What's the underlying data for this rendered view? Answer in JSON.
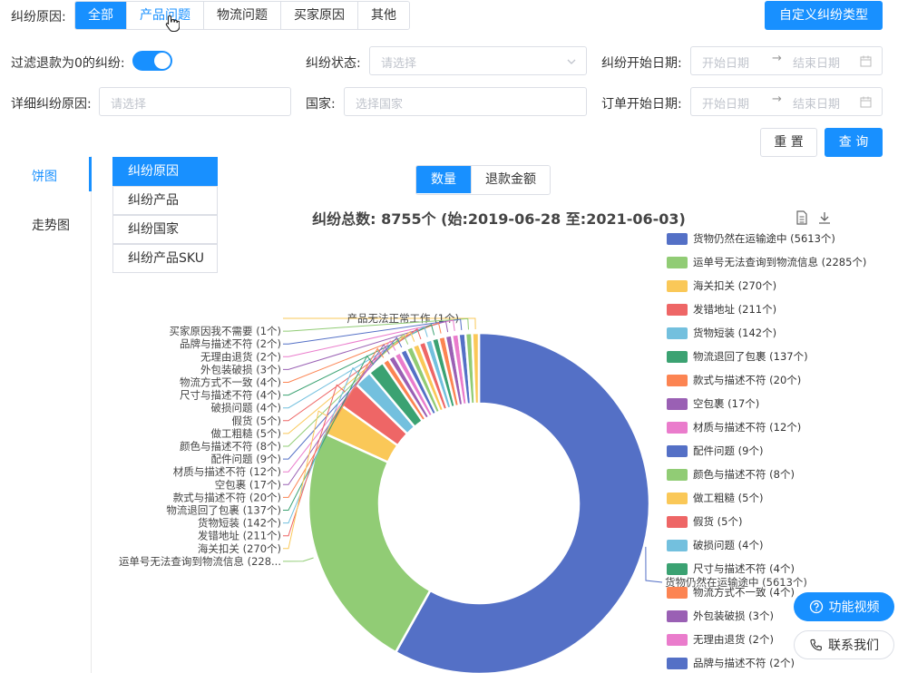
{
  "filters": {
    "reason_label": "纠纷原因:",
    "reason_tabs": [
      "全部",
      "产品问题",
      "物流问题",
      "买家原因",
      "其他"
    ],
    "custom_type_button": "自定义纠纷类型",
    "filter_zero_refund_label": "过滤退款为0的纠纷:",
    "status_label": "纠纷状态:",
    "status_placeholder": "请选择",
    "dispute_start_label": "纠纷开始日期:",
    "start_date_placeholder": "开始日期",
    "end_date_placeholder": "结束日期",
    "detail_reason_label": "详细纠纷原因:",
    "detail_reason_placeholder": "请选择",
    "country_label": "国家:",
    "country_placeholder": "选择国家",
    "order_start_label": "订单开始日期:",
    "order_start_date_placeholder": "开始日期",
    "order_end_date_placeholder": "结束日期",
    "reset_button": "重 置",
    "query_button": "查 询"
  },
  "side_tabs": [
    "饼图",
    "走势图"
  ],
  "dimension_buttons": [
    "纠纷原因",
    "纠纷产品",
    "纠纷国家",
    "纠纷产品SKU"
  ],
  "metric_tabs": [
    "数量",
    "退款金额"
  ],
  "float_buttons": {
    "video": "功能视频",
    "contact": "联系我们"
  },
  "colors": {
    "primary": "#1890ff"
  },
  "chart_data": {
    "type": "pie",
    "donut": true,
    "title": "纠纷总数: 8755个 (始:2019-06-28 至:2021-06-03)",
    "legend_position": "right",
    "callout_label": "货物仍然在运输途中 (5613个)",
    "truncated_label": "运单号无法查询到物流信息 (228...",
    "series": [
      {
        "name": "货物仍然在运输途中",
        "value": 5613,
        "label": "货物仍然在运输途中 (5613个)",
        "color": "#5470c6"
      },
      {
        "name": "运单号无法查询到物流信息",
        "value": 2285,
        "label": "运单号无法查询到物流信息 (2285个)",
        "color": "#91cc75"
      },
      {
        "name": "海关扣关",
        "value": 270,
        "label": "海关扣关 (270个)",
        "color": "#fac858"
      },
      {
        "name": "发错地址",
        "value": 211,
        "label": "发错地址 (211个)",
        "color": "#ee6666"
      },
      {
        "name": "货物短装",
        "value": 142,
        "label": "货物短装 (142个)",
        "color": "#73c0de"
      },
      {
        "name": "物流退回了包裹",
        "value": 137,
        "label": "物流退回了包裹 (137个)",
        "color": "#3ba272"
      },
      {
        "name": "款式与描述不符",
        "value": 20,
        "label": "款式与描述不符 (20个)",
        "color": "#fc8452"
      },
      {
        "name": "空包裹",
        "value": 17,
        "label": "空包裹 (17个)",
        "color": "#9a60b4"
      },
      {
        "name": "材质与描述不符",
        "value": 12,
        "label": "材质与描述不符 (12个)",
        "color": "#ea7ccc"
      },
      {
        "name": "配件问题",
        "value": 9,
        "label": "配件问题 (9个)",
        "color": "#5470c6"
      },
      {
        "name": "颜色与描述不符",
        "value": 8,
        "label": "颜色与描述不符 (8个)",
        "color": "#91cc75"
      },
      {
        "name": "做工粗糙",
        "value": 5,
        "label": "做工粗糙 (5个)",
        "color": "#fac858"
      },
      {
        "name": "假货",
        "value": 5,
        "label": "假货 (5个)",
        "color": "#ee6666"
      },
      {
        "name": "破损问题",
        "value": 4,
        "label": "破损问题 (4个)",
        "color": "#73c0de"
      },
      {
        "name": "尺寸与描述不符",
        "value": 4,
        "label": "尺寸与描述不符 (4个)",
        "color": "#3ba272"
      },
      {
        "name": "物流方式不一致",
        "value": 4,
        "label": "物流方式不一致 (4个)",
        "color": "#fc8452"
      },
      {
        "name": "外包装破损",
        "value": 3,
        "label": "外包装破损 (3个)",
        "color": "#9a60b4"
      },
      {
        "name": "无理由退货",
        "value": 2,
        "label": "无理由退货 (2个)",
        "color": "#ea7ccc"
      },
      {
        "name": "品牌与描述不符",
        "value": 2,
        "label": "品牌与描述不符 (2个)",
        "color": "#5470c6"
      },
      {
        "name": "买家原因我不需要",
        "value": 1,
        "label": "买家原因我不需要 (1个)",
        "color": "#91cc75"
      },
      {
        "name": "产品无法正常工作",
        "value": 1,
        "label": "产品无法正常工作 (1个)",
        "color": "#fac858"
      }
    ]
  }
}
